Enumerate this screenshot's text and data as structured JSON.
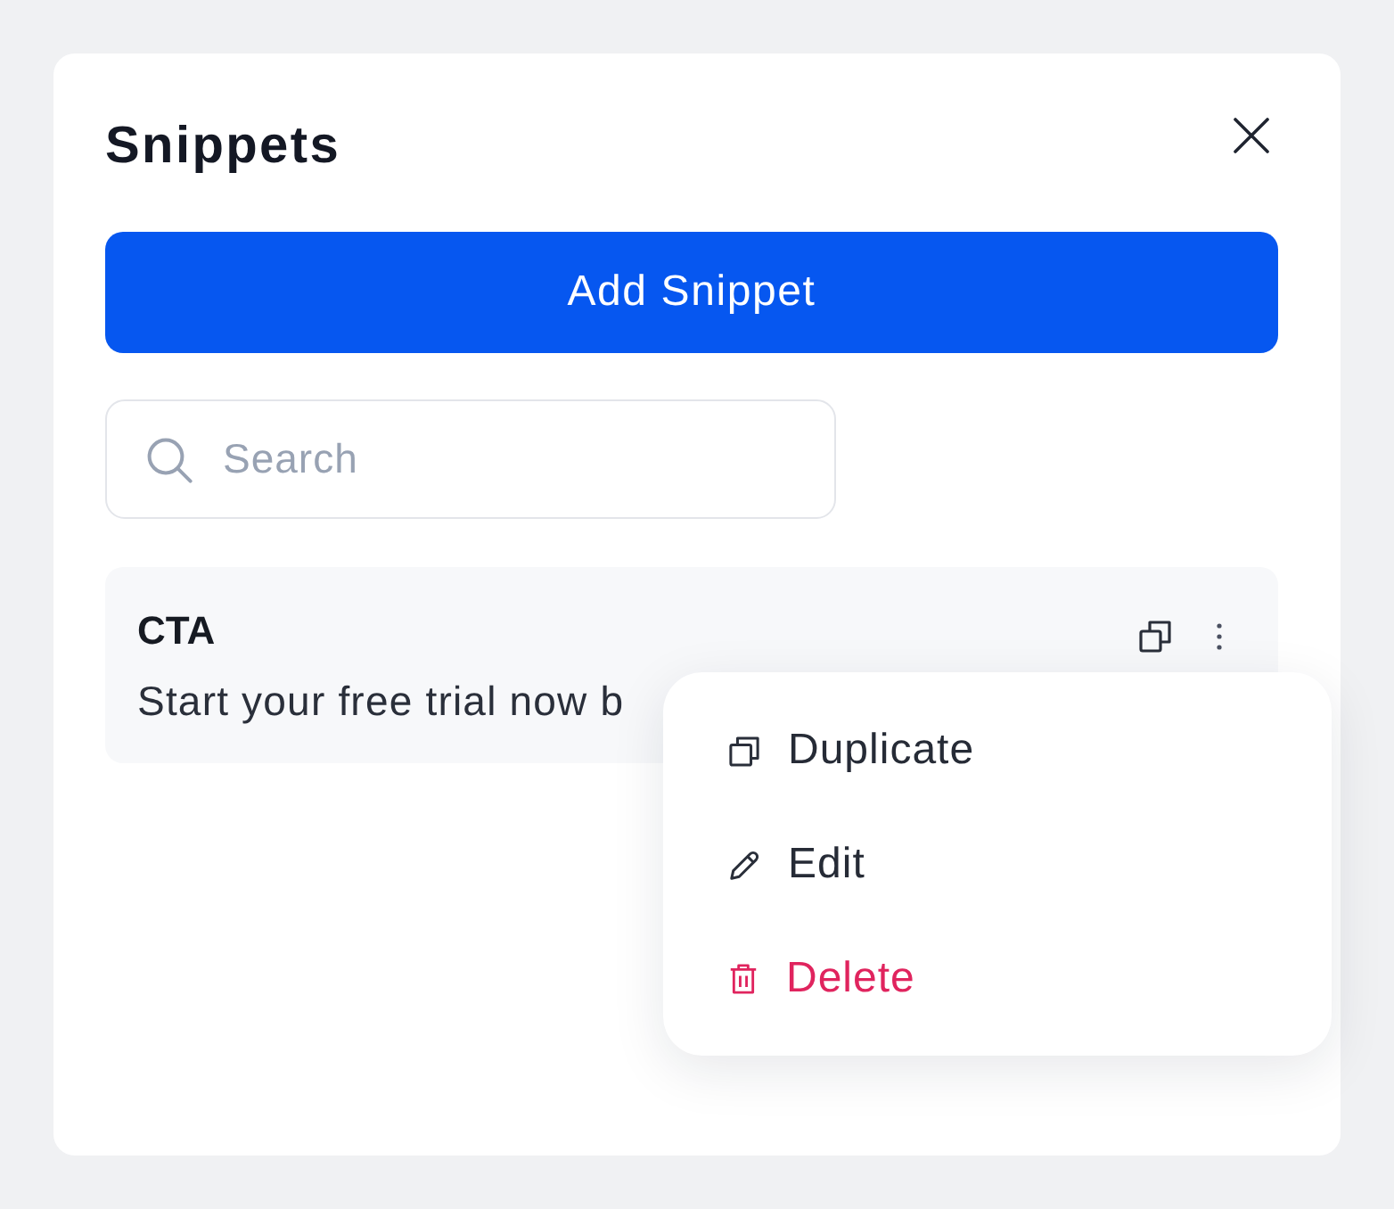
{
  "panel": {
    "title": "Snippets"
  },
  "add_button": {
    "label": "Add Snippet"
  },
  "search": {
    "placeholder": "Search"
  },
  "snippets": [
    {
      "title": "CTA",
      "preview": "Start your free trial now b"
    }
  ],
  "context_menu": {
    "items": [
      {
        "label": "Duplicate",
        "kind": "duplicate"
      },
      {
        "label": "Edit",
        "kind": "edit"
      },
      {
        "label": "Delete",
        "kind": "delete"
      }
    ]
  }
}
